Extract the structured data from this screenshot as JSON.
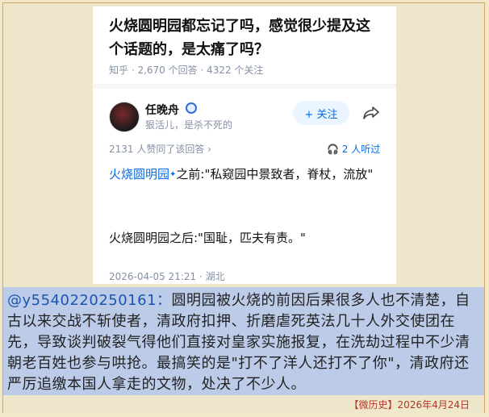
{
  "question": {
    "title": "火烧圆明园都忘记了吗，感觉很少提及这个话题的，是太痛了吗？",
    "meta": "知乎 · 2,670 个回答 · 4322 个关注"
  },
  "author": {
    "name": "任晚舟",
    "bio": "狠活儿，是杀不死的",
    "follow_label": "+ 关注",
    "share_icon": "share-icon"
  },
  "stats": {
    "votes": "2131 人赞同了该回答 ›",
    "listen": "2 人听过"
  },
  "answer": {
    "topic": "火烧圆明园",
    "line1_rest": "之前:\"私窥园中景致者，脊杖，流放\"",
    "line2": "火烧圆明园之后:\"国耻，匹夫有责。\"",
    "date": "2026-04-05 21:21 · 湖北"
  },
  "comment": {
    "user": "@y5540220250161：",
    "text": "圆明园被火烧的前因后果很多人也不清楚，自古以来交战不斩使者，清政府扣押、折磨虐死英法几十人外交使团在先，导致谈判破裂气得他们直接对皇家实施报复，在洗劫过程中不少清朝老百姓也参与哄抢。最搞笑的是\"打不了洋人还打不了你\"，清政府还严厉追缴本国人拿走的文物，处决了不少人。"
  },
  "footer": {
    "tag": "【微历史】2026年4月24日"
  }
}
